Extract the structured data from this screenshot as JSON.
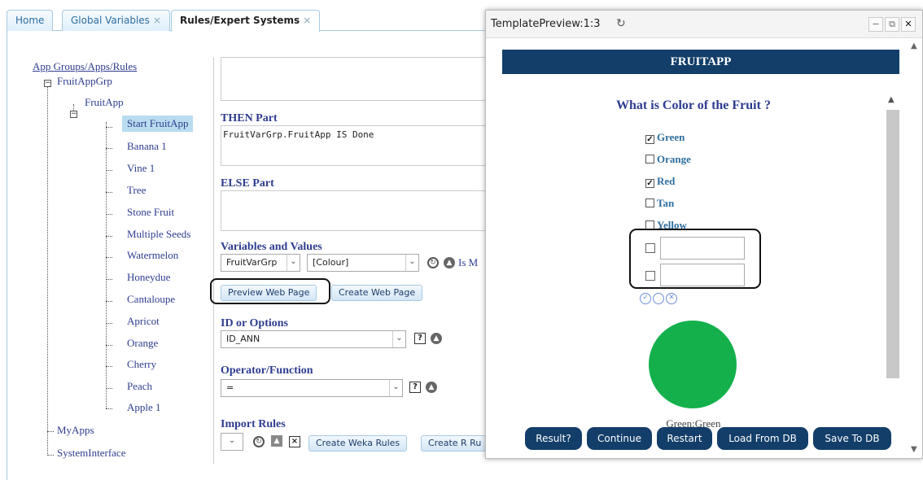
{
  "tabs": [
    {
      "label": "Home",
      "closable": false
    },
    {
      "label": "Global Variables",
      "closable": true
    },
    {
      "label": "Rules/Expert Systems",
      "closable": true
    }
  ],
  "tab_close_glyph": "×",
  "tree": {
    "root": "App Groups/Apps/Rules",
    "group": "FruitAppGrp",
    "app": "FruitApp",
    "rules": [
      "Start FruitApp",
      "Banana 1",
      "Vine 1",
      "Tree",
      "Stone Fruit",
      "Multiple Seeds",
      "Watermelon",
      "Honeydue",
      "Cantaloupe",
      "Apricot",
      "Orange",
      "Cherry",
      "Peach",
      "Apple 1"
    ],
    "other_groups": [
      "MyApps",
      "SystemInterface"
    ]
  },
  "editor": {
    "then_label": "THEN Part",
    "then_value": "FruitVarGrp.FruitApp IS Done",
    "else_label": "ELSE Part",
    "vars_label": "Variables and Values",
    "var_group": "FruitVarGrp",
    "var_name": "[Colour]",
    "is_text": "Is M",
    "preview_btn": "Preview Web Page",
    "create_btn": "Create Web Page",
    "id_label": "ID or Options",
    "id_value": "ID_ANN",
    "op_label": "Operator/Function",
    "op_value": "=",
    "import_label": "Import Rules",
    "weka_btn": "Create Weka Rules",
    "r_btn": "Create R Ru"
  },
  "preview": {
    "window_title": "TemplatePreview:1:3",
    "app_title": "FRUITAPP",
    "question": "What is Color of the Fruit ?",
    "options": [
      {
        "label": "Green",
        "checked": true
      },
      {
        "label": "Orange",
        "checked": false
      },
      {
        "label": "Red",
        "checked": true
      },
      {
        "label": "Tan",
        "checked": false
      },
      {
        "label": "Yellow",
        "checked": false
      }
    ],
    "result_text": "Green:Green",
    "circle_color": "#13b04b",
    "buttons": [
      "Result?",
      "Continue",
      "Restart",
      "Load From DB",
      "Save To DB"
    ]
  },
  "colors": {
    "accent": "#133e69",
    "link": "#2e3d8f",
    "selected_bg": "#b9dcf0"
  }
}
